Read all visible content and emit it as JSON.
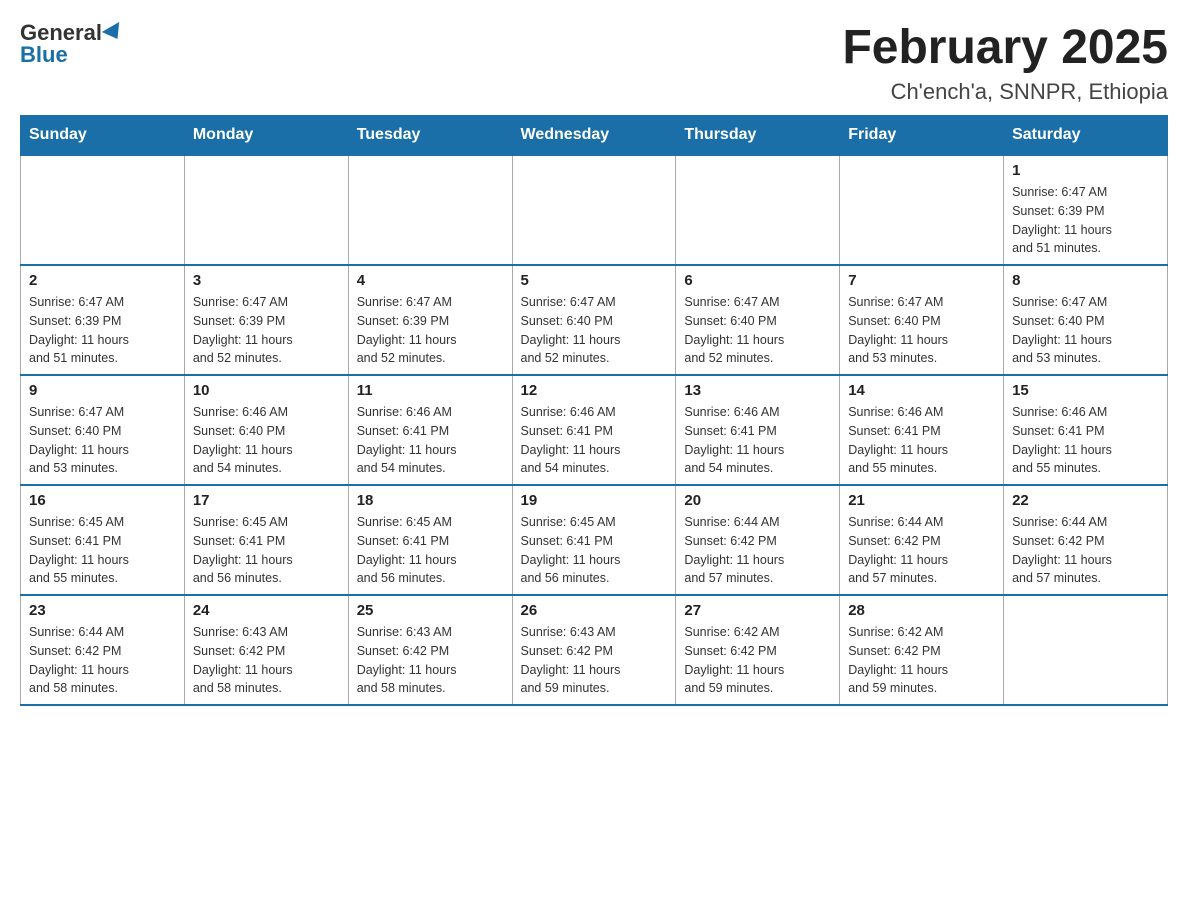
{
  "logo": {
    "general": "General",
    "blue": "Blue"
  },
  "title": "February 2025",
  "location": "Ch'ench'a, SNNPR, Ethiopia",
  "days_header": [
    "Sunday",
    "Monday",
    "Tuesday",
    "Wednesday",
    "Thursday",
    "Friday",
    "Saturday"
  ],
  "weeks": [
    [
      {
        "day": "",
        "info": ""
      },
      {
        "day": "",
        "info": ""
      },
      {
        "day": "",
        "info": ""
      },
      {
        "day": "",
        "info": ""
      },
      {
        "day": "",
        "info": ""
      },
      {
        "day": "",
        "info": ""
      },
      {
        "day": "1",
        "info": "Sunrise: 6:47 AM\nSunset: 6:39 PM\nDaylight: 11 hours\nand 51 minutes."
      }
    ],
    [
      {
        "day": "2",
        "info": "Sunrise: 6:47 AM\nSunset: 6:39 PM\nDaylight: 11 hours\nand 51 minutes."
      },
      {
        "day": "3",
        "info": "Sunrise: 6:47 AM\nSunset: 6:39 PM\nDaylight: 11 hours\nand 52 minutes."
      },
      {
        "day": "4",
        "info": "Sunrise: 6:47 AM\nSunset: 6:39 PM\nDaylight: 11 hours\nand 52 minutes."
      },
      {
        "day": "5",
        "info": "Sunrise: 6:47 AM\nSunset: 6:40 PM\nDaylight: 11 hours\nand 52 minutes."
      },
      {
        "day": "6",
        "info": "Sunrise: 6:47 AM\nSunset: 6:40 PM\nDaylight: 11 hours\nand 52 minutes."
      },
      {
        "day": "7",
        "info": "Sunrise: 6:47 AM\nSunset: 6:40 PM\nDaylight: 11 hours\nand 53 minutes."
      },
      {
        "day": "8",
        "info": "Sunrise: 6:47 AM\nSunset: 6:40 PM\nDaylight: 11 hours\nand 53 minutes."
      }
    ],
    [
      {
        "day": "9",
        "info": "Sunrise: 6:47 AM\nSunset: 6:40 PM\nDaylight: 11 hours\nand 53 minutes."
      },
      {
        "day": "10",
        "info": "Sunrise: 6:46 AM\nSunset: 6:40 PM\nDaylight: 11 hours\nand 54 minutes."
      },
      {
        "day": "11",
        "info": "Sunrise: 6:46 AM\nSunset: 6:41 PM\nDaylight: 11 hours\nand 54 minutes."
      },
      {
        "day": "12",
        "info": "Sunrise: 6:46 AM\nSunset: 6:41 PM\nDaylight: 11 hours\nand 54 minutes."
      },
      {
        "day": "13",
        "info": "Sunrise: 6:46 AM\nSunset: 6:41 PM\nDaylight: 11 hours\nand 54 minutes."
      },
      {
        "day": "14",
        "info": "Sunrise: 6:46 AM\nSunset: 6:41 PM\nDaylight: 11 hours\nand 55 minutes."
      },
      {
        "day": "15",
        "info": "Sunrise: 6:46 AM\nSunset: 6:41 PM\nDaylight: 11 hours\nand 55 minutes."
      }
    ],
    [
      {
        "day": "16",
        "info": "Sunrise: 6:45 AM\nSunset: 6:41 PM\nDaylight: 11 hours\nand 55 minutes."
      },
      {
        "day": "17",
        "info": "Sunrise: 6:45 AM\nSunset: 6:41 PM\nDaylight: 11 hours\nand 56 minutes."
      },
      {
        "day": "18",
        "info": "Sunrise: 6:45 AM\nSunset: 6:41 PM\nDaylight: 11 hours\nand 56 minutes."
      },
      {
        "day": "19",
        "info": "Sunrise: 6:45 AM\nSunset: 6:41 PM\nDaylight: 11 hours\nand 56 minutes."
      },
      {
        "day": "20",
        "info": "Sunrise: 6:44 AM\nSunset: 6:42 PM\nDaylight: 11 hours\nand 57 minutes."
      },
      {
        "day": "21",
        "info": "Sunrise: 6:44 AM\nSunset: 6:42 PM\nDaylight: 11 hours\nand 57 minutes."
      },
      {
        "day": "22",
        "info": "Sunrise: 6:44 AM\nSunset: 6:42 PM\nDaylight: 11 hours\nand 57 minutes."
      }
    ],
    [
      {
        "day": "23",
        "info": "Sunrise: 6:44 AM\nSunset: 6:42 PM\nDaylight: 11 hours\nand 58 minutes."
      },
      {
        "day": "24",
        "info": "Sunrise: 6:43 AM\nSunset: 6:42 PM\nDaylight: 11 hours\nand 58 minutes."
      },
      {
        "day": "25",
        "info": "Sunrise: 6:43 AM\nSunset: 6:42 PM\nDaylight: 11 hours\nand 58 minutes."
      },
      {
        "day": "26",
        "info": "Sunrise: 6:43 AM\nSunset: 6:42 PM\nDaylight: 11 hours\nand 59 minutes."
      },
      {
        "day": "27",
        "info": "Sunrise: 6:42 AM\nSunset: 6:42 PM\nDaylight: 11 hours\nand 59 minutes."
      },
      {
        "day": "28",
        "info": "Sunrise: 6:42 AM\nSunset: 6:42 PM\nDaylight: 11 hours\nand 59 minutes."
      },
      {
        "day": "",
        "info": ""
      }
    ]
  ]
}
